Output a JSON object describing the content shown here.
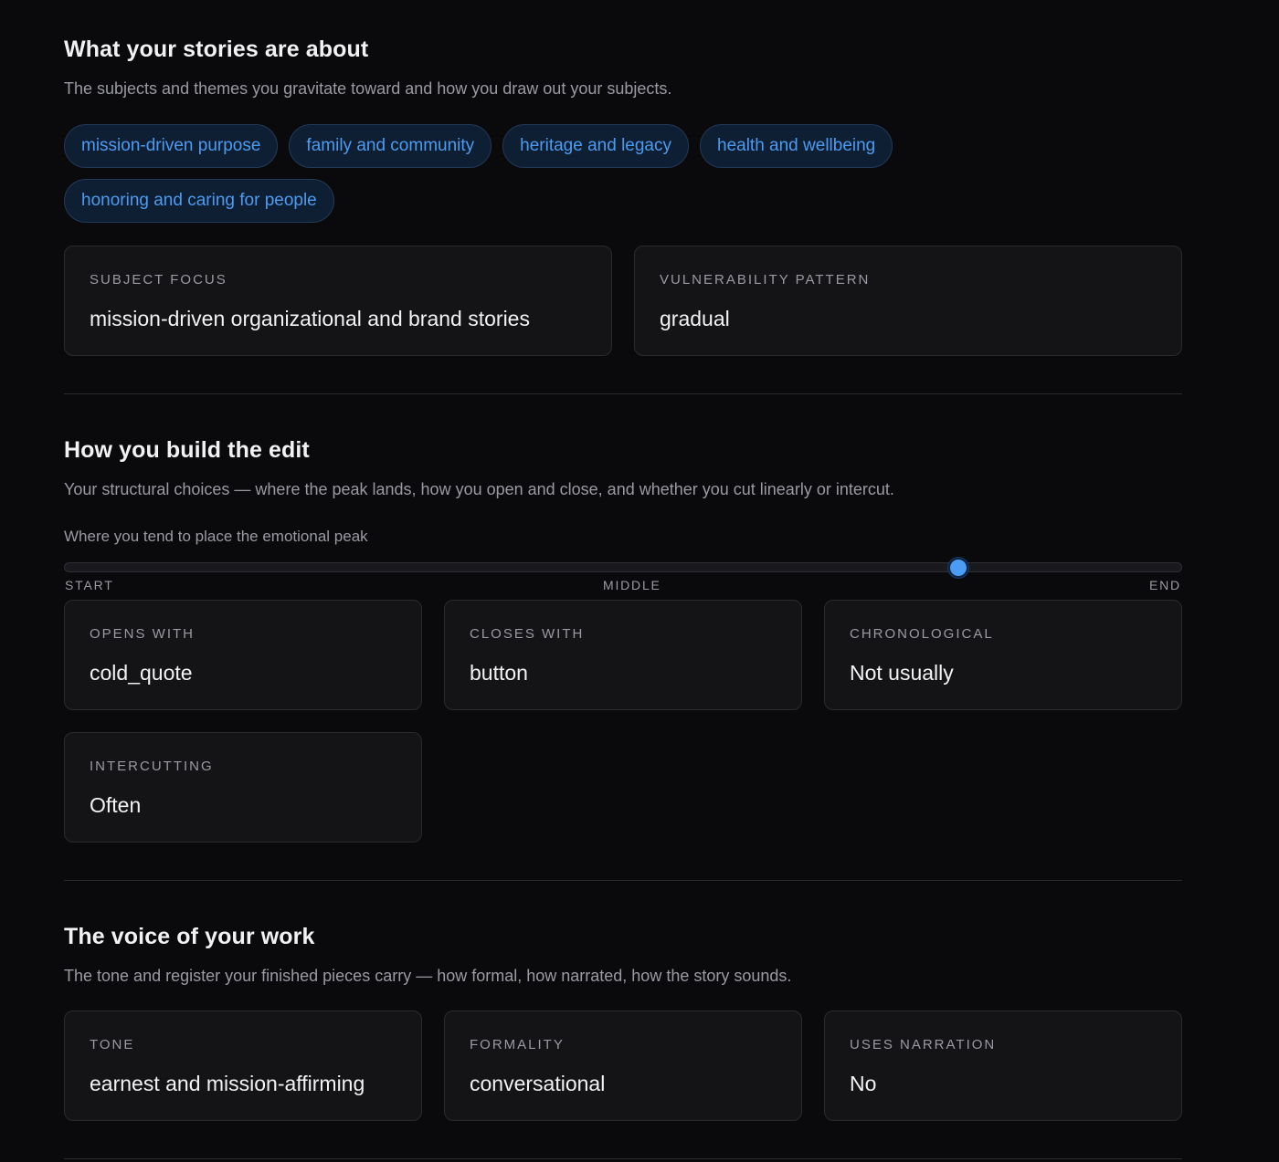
{
  "themes_section": {
    "title": "What your stories are about",
    "description": "The subjects and themes you gravitate toward and how you draw out your subjects.",
    "tags": [
      "mission-driven purpose",
      "family and community",
      "heritage and legacy",
      "health and wellbeing",
      "honoring and caring for people"
    ],
    "cards": [
      {
        "label": "SUBJECT FOCUS",
        "value": "mission-driven organizational and brand stories"
      },
      {
        "label": "VULNERABILITY PATTERN",
        "value": "gradual"
      }
    ]
  },
  "structure_section": {
    "title": "How you build the edit",
    "description": "Your structural choices — where the peak lands, how you open and close, and whether you cut linearly or intercut.",
    "peak_slider": {
      "label": "Where you tend to place the emotional peak",
      "value": 0.8,
      "start_label": "START",
      "middle_label": "MIDDLE",
      "end_label": "END"
    },
    "cards": [
      {
        "label": "OPENS WITH",
        "value": "cold_quote"
      },
      {
        "label": "CLOSES WITH",
        "value": "button"
      },
      {
        "label": "CHRONOLOGICAL",
        "value": "Not usually"
      },
      {
        "label": "INTERCUTTING",
        "value": "Often"
      }
    ]
  },
  "voice_section": {
    "title": "The voice of your work",
    "description": "The tone and register your finished pieces carry — how formal, how narrated, how the story sounds.",
    "cards": [
      {
        "label": "TONE",
        "value": "earnest and mission-affirming"
      },
      {
        "label": "FORMALITY",
        "value": "conversational"
      },
      {
        "label": "USES NARRATION",
        "value": "No"
      }
    ]
  },
  "colors": {
    "background": "#0a0a0c",
    "card": "#141417",
    "accent": "#4a9cf5",
    "tag_background": "#0f1f33"
  }
}
